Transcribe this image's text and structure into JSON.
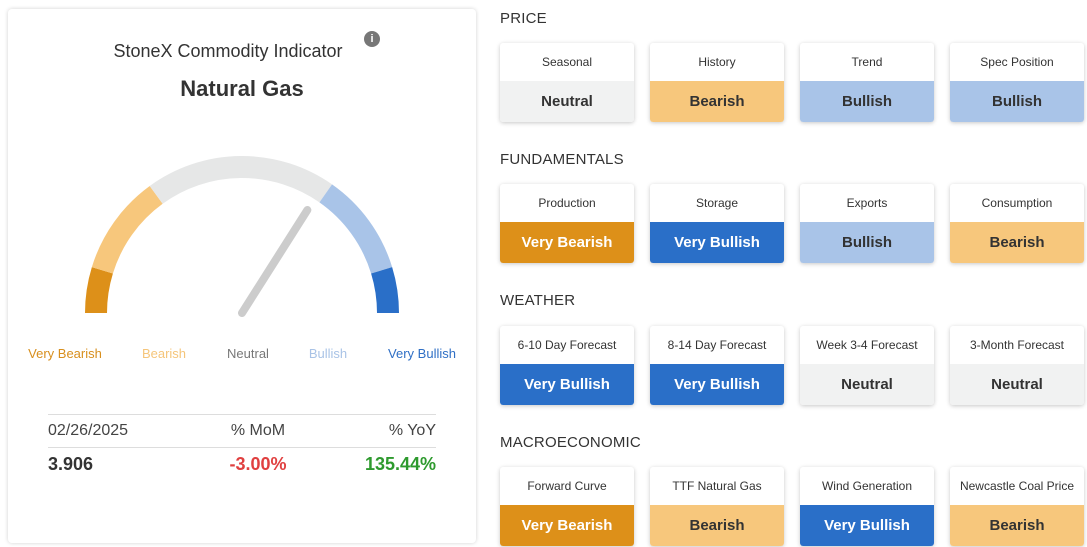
{
  "indicator": {
    "title": "StoneX Commodity Indicator",
    "info_icon": "info-icon",
    "commodity": "Natural Gas",
    "gauge": {
      "labels": [
        "Very Bearish",
        "Bearish",
        "Neutral",
        "Bullish",
        "Very Bullish"
      ],
      "needle_value": 0.68,
      "colors": {
        "very_bearish": "#DD9019",
        "bearish": "#F7C77C",
        "neutral": "#E6E7E7",
        "bullish": "#A9C4E8",
        "very_bullish": "#2A6FC8",
        "needle": "#CCCCCC"
      }
    },
    "stats": {
      "date": "02/26/2025",
      "mom_label": "% MoM",
      "yoy_label": "% YoY",
      "price": "3.906",
      "mom": "-3.00%",
      "yoy": "135.44%"
    }
  },
  "sections": [
    {
      "title": "PRICE",
      "tiles": [
        {
          "label": "Seasonal",
          "value": "Neutral",
          "status": "neutral"
        },
        {
          "label": "History",
          "value": "Bearish",
          "status": "bear"
        },
        {
          "label": "Trend",
          "value": "Bullish",
          "status": "bull"
        },
        {
          "label": "Spec Position",
          "value": "Bullish",
          "status": "bull"
        }
      ]
    },
    {
      "title": "FUNDAMENTALS",
      "tiles": [
        {
          "label": "Production",
          "value": "Very Bearish",
          "status": "vbear"
        },
        {
          "label": "Storage",
          "value": "Very Bullish",
          "status": "vbull"
        },
        {
          "label": "Exports",
          "value": "Bullish",
          "status": "bull"
        },
        {
          "label": "Consumption",
          "value": "Bearish",
          "status": "bear"
        }
      ]
    },
    {
      "title": "WEATHER",
      "tiles": [
        {
          "label": "6-10 Day Forecast",
          "value": "Very Bullish",
          "status": "vbull"
        },
        {
          "label": "8-14 Day Forecast",
          "value": "Very Bullish",
          "status": "vbull"
        },
        {
          "label": "Week 3-4 Forecast",
          "value": "Neutral",
          "status": "neutral"
        },
        {
          "label": "3-Month Forecast",
          "value": "Neutral",
          "status": "neutral"
        }
      ]
    },
    {
      "title": "MACROECONOMIC",
      "tiles": [
        {
          "label": "Forward Curve",
          "value": "Very Bearish",
          "status": "vbear"
        },
        {
          "label": "TTF Natural Gas",
          "value": "Bearish",
          "status": "bear"
        },
        {
          "label": "Wind Generation",
          "value": "Very Bullish",
          "status": "vbull"
        },
        {
          "label": "Newcastle Coal Price",
          "value": "Bearish",
          "status": "bear"
        }
      ]
    }
  ]
}
